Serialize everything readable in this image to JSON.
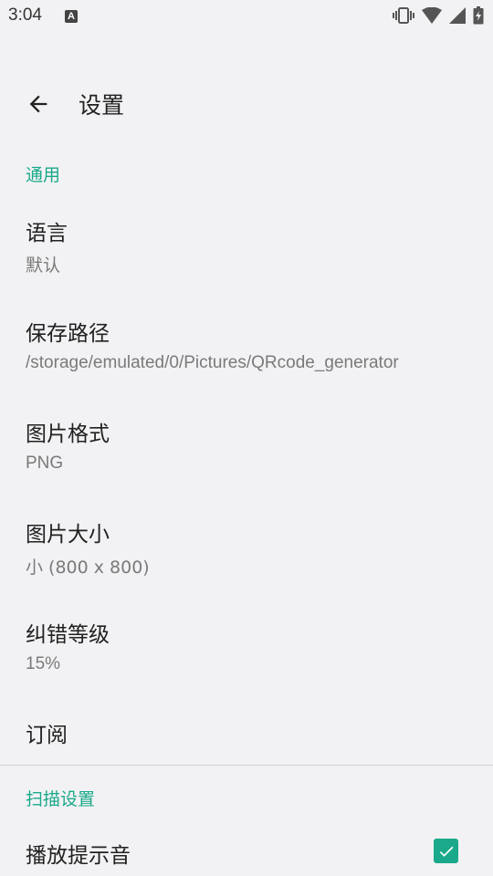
{
  "status_bar": {
    "time": "3:04",
    "notification_icon": "a-icon",
    "notification_glyph": "A",
    "icons": [
      "vibrate-icon",
      "wifi-icon",
      "signal-icon",
      "battery-charging-icon"
    ]
  },
  "toolbar": {
    "back_icon": "arrow-left-icon",
    "title": "设置"
  },
  "sections": {
    "general": {
      "header": "通用",
      "items": [
        {
          "title": "语言",
          "summary": "默认"
        },
        {
          "title": "保存路径",
          "summary": "/storage/emulated/0/Pictures/QRcode_generator"
        },
        {
          "title": "图片格式",
          "summary": "PNG"
        },
        {
          "title": "图片大小",
          "summary": "小 (800 x 800)"
        },
        {
          "title": "纠错等级",
          "summary": "15%"
        },
        {
          "title": "订阅"
        }
      ]
    },
    "scan": {
      "header": "扫描设置",
      "items": [
        {
          "title": "播放提示音",
          "checked": true
        }
      ]
    }
  },
  "colors": {
    "accent": "#1aa98a",
    "background": "#f2f2f4",
    "title_text": "#212121",
    "summary_text": "#7a7a7a"
  }
}
